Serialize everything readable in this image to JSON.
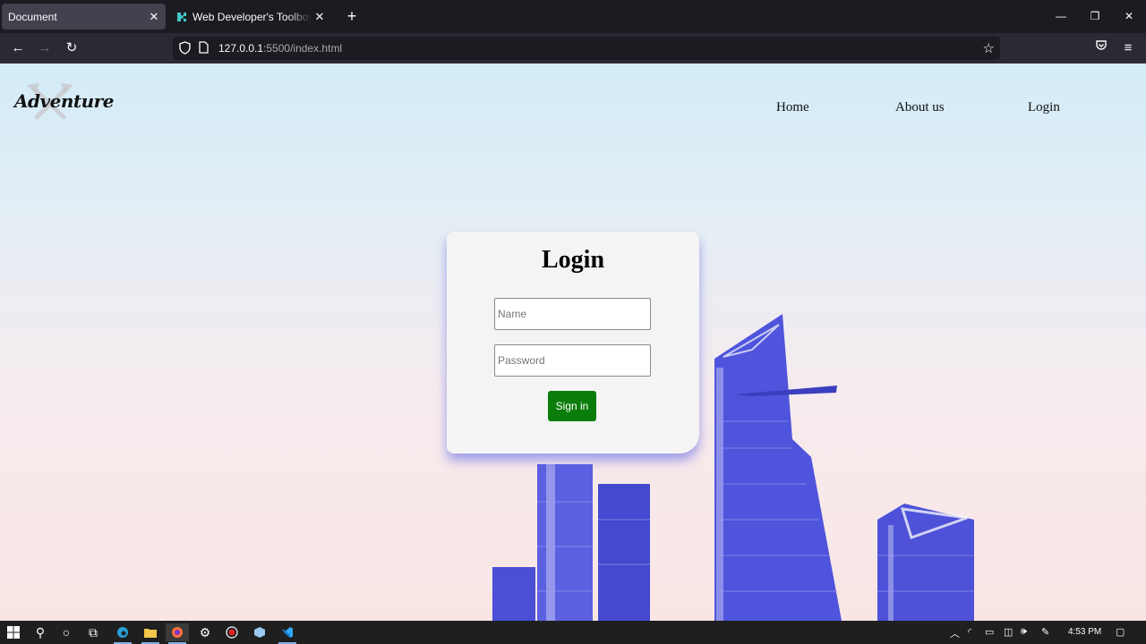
{
  "browser": {
    "tabs": [
      {
        "title": "Document",
        "active": true
      },
      {
        "title": "Web Developer's Toolbox – Add",
        "active": false
      }
    ],
    "url_host": "127.0.0.1",
    "url_rest": ":5500/index.html"
  },
  "site": {
    "logo_text": "Adventure",
    "nav": [
      "Home",
      "About us",
      "Login"
    ]
  },
  "login": {
    "title": "Login",
    "name_placeholder": "Name",
    "password_placeholder": "Password",
    "submit_label": "Sign in",
    "submit_color": "#0a7d0a"
  },
  "taskbar": {
    "time": "4:53 PM"
  }
}
